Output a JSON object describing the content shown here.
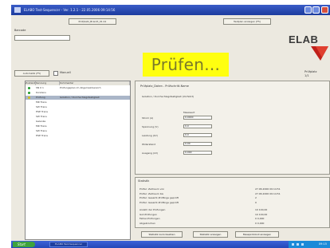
{
  "window": {
    "title": "ELABO Test-Sequencer - Ver. 1.2.1 - 22.05.2006 09:14:56"
  },
  "topbar": {
    "tab_label": "Prüfplatz_Brandt_01.b1",
    "right_button_label": "Testplan anzeigen (F5)"
  },
  "left": {
    "field_label": "Barcode",
    "run_button_label": "Automatik (F5)",
    "checkbox_label": "Manuell"
  },
  "status_banner": "Prüfen...",
  "logo": "ELAB",
  "right_info": {
    "label": "Prüfplatz",
    "value": "1/1"
  },
  "list": {
    "headers": [
      "Zustand",
      "Kennung",
      "Kommentar"
    ],
    "rows": [
      {
        "state": "ok",
        "code": "SN 0 1",
        "text": "Prüfungsplan im Allgemeinbereich"
      },
      {
        "state": "ok",
        "code": "Kondens",
        "text": ""
      },
      {
        "state": "run",
        "code": "Prüfung",
        "text": "Isolation / Durchschlagsfestigkeit"
      },
      {
        "state": "none",
        "code": "MR Trans",
        "text": ""
      },
      {
        "state": "none",
        "code": "SW Trans",
        "text": ""
      },
      {
        "state": "none",
        "code": "HSE Trans",
        "text": ""
      },
      {
        "state": "none",
        "code": "SW Trans",
        "text": ""
      },
      {
        "state": "none",
        "code": "Gelenke",
        "text": ""
      },
      {
        "state": "none",
        "code": "MR Trans",
        "text": ""
      },
      {
        "state": "none",
        "code": "SW Trans",
        "text": ""
      },
      {
        "state": "none",
        "code": "HSE Trans",
        "text": ""
      }
    ]
  },
  "measure_panel": {
    "title": "Prüfplatz_Daten - Prüfschritt-Name",
    "subtitle": "Isolation / Durchschlagsfestigkeit (Vorfahrt)",
    "column_header": "Messwert",
    "rows": [
      {
        "label": "Strom (A)",
        "value": "0,0000"
      },
      {
        "label": "Spannung (V)",
        "value": "0,0"
      },
      {
        "label": "Leistung (kV)",
        "value": "0,0"
      },
      {
        "label": "Widerstand",
        "value": "0,00"
      },
      {
        "label": "Ausgang (kV)",
        "value": "0,000"
      }
    ]
  },
  "result_panel": {
    "title": "Statistik",
    "lines": [
      {
        "label": "Prüfer: Zeitraum von",
        "value": "27.06.2006 09:14:51"
      },
      {
        "label": "Prüfer: Zeitraum bis",
        "value": "27.06.2006 09:14:51"
      },
      {
        "label": "Prüfer: Gesamt-Prüflinge geprüft",
        "value": "2"
      },
      {
        "label": "Prüfer: Gesamt-Prüflinge geprüft",
        "value": "0"
      },
      {
        "label": "Anzahl der Prüfungen",
        "value": "10   100,00"
      },
      {
        "label": "Gut-Prüfungen",
        "value": "10   100,00"
      },
      {
        "label": "Fehler-Prüfungen",
        "value": "0    0,000"
      },
      {
        "label": "Abgebrochen",
        "value": "0    0,000"
      }
    ]
  },
  "bottom_buttons": [
    "Statistik zurücksetzen",
    "Statistik anzeigen",
    "Messprotokoll anzeigen"
  ],
  "taskbar": {
    "start_label": "Start",
    "task_label": "ELABO Test-Sequencer",
    "clock": "09:15"
  },
  "colors": {
    "titlebar": "#1c3c9e",
    "banner": "#ffff10",
    "state_ok": "#1f9a2a",
    "state_run": "#d4c012",
    "logo_red": "#c0201a"
  }
}
